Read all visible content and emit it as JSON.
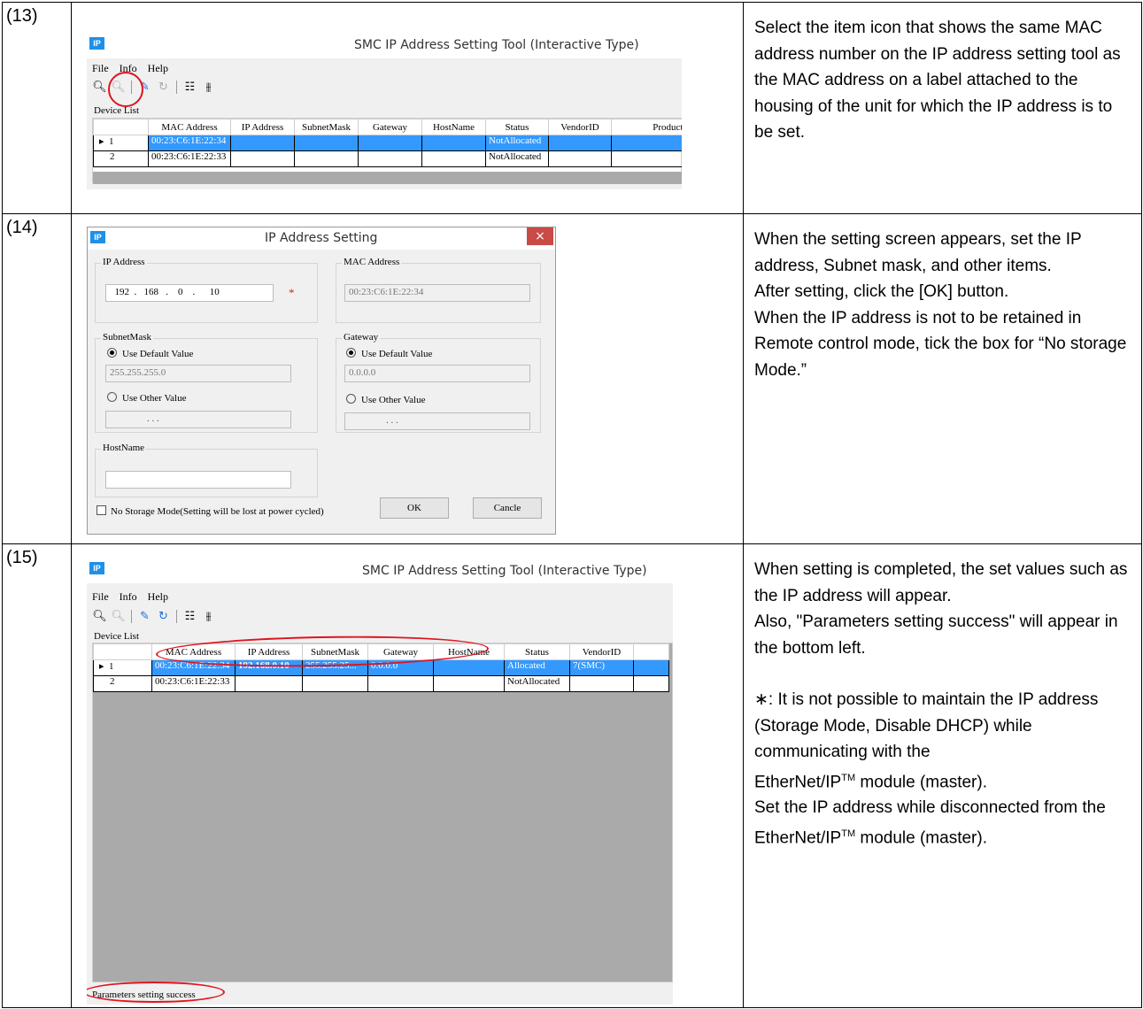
{
  "steps": [
    {
      "number": "(13)",
      "description": [
        "Select the item icon that shows the same MAC address number on the IP address setting tool as the MAC address on a label attached to the housing of the unit for which the IP address is to be set."
      ],
      "window": {
        "title": "SMC IP Address Setting Tool (Interactive Type)",
        "icon": "IP",
        "menu": [
          "File",
          "Info",
          "Help"
        ],
        "device_list_label": "Device List",
        "columns": [
          "MAC Address",
          "IP Address",
          "SubnetMask",
          "Gateway",
          "HostName",
          "Status",
          "VendorID",
          "ProductC"
        ],
        "rows": [
          {
            "index": "1",
            "mac": "00:23:C6:1E:22:34",
            "ip": "",
            "subnet": "",
            "gateway": "",
            "host": "",
            "status": "NotAllocated",
            "vendor": "",
            "product": ""
          },
          {
            "index": "2",
            "mac": "00:23:C6:1E:22:33",
            "ip": "",
            "subnet": "",
            "gateway": "",
            "host": "",
            "status": "NotAllocated",
            "vendor": "",
            "product": ""
          }
        ]
      }
    },
    {
      "number": "(14)",
      "description": [
        "When the setting screen appears, set the IP address, Subnet mask, and other items.",
        "After setting, click the [OK] button.",
        "When the IP address is not to be retained in Remote control mode, tick the box for “No storage Mode.”"
      ],
      "dialog": {
        "title": "IP Address Setting",
        "icon": "IP",
        "close": "×",
        "ip_label": "IP Address",
        "ip_parts": [
          "192",
          "168",
          "0",
          "10"
        ],
        "ip_dots": [
          ".",
          ".",
          "."
        ],
        "required_mark": "*",
        "mac_label": "MAC Address",
        "mac_value": "00:23:C6:1E:22:34",
        "subnet_label": "SubnetMask",
        "subnet_default": "Use Default Value",
        "subnet_default_value": "255.255.255.0",
        "subnet_other": "Use Other Value",
        "subnet_other_value": ".            .            .",
        "gateway_label": "Gateway",
        "gateway_default": "Use Default Value",
        "gateway_default_value": "0.0.0.0",
        "gateway_other": "Use Other Value",
        "gateway_other_value": ".            .            .",
        "hostname_label": "HostName",
        "hostname_value": "",
        "nostorage_label": "No Storage Mode(Setting will be lost at power cycled)",
        "ok_label": "OK",
        "cancel_label": "Cancle"
      }
    },
    {
      "number": "(15)",
      "description": [
        "When setting is completed, the set values such as the IP address will appear.",
        "Also, \"Parameters setting success\" will appear in the bottom left."
      ],
      "note": {
        "lines": [
          "∗: It is not possible to maintain the IP address (Storage Mode, Disable DHCP) while communicating with the"
        ],
        "tm1_pre": "EtherNet/IP",
        "tm1_sup": "TM",
        "tm1_post": " module (master).",
        "set_line": "Set the IP address while disconnected from the ",
        "tm2_pre": "EtherNet/IP",
        "tm2_sup": "TM",
        "tm2_post": " module (master)."
      },
      "window": {
        "title": "SMC IP Address Setting Tool (Interactive Type)",
        "icon": "IP",
        "menu": [
          "File",
          "Info",
          "Help"
        ],
        "device_list_label": "Device List",
        "columns": [
          "MAC Address",
          "IP Address",
          "SubnetMask",
          "Gateway",
          "HostName",
          "Status",
          "VendorID"
        ],
        "rows": [
          {
            "index": "1",
            "mac": "00:23:C6:1E:22:34",
            "ip": "192.168.0.10",
            "subnet": "255.255.25...",
            "gateway": "0.0.0.0",
            "host": "",
            "status": "Allocated",
            "vendor": "7(SMC)"
          },
          {
            "index": "2",
            "mac": "00:23:C6:1E:22:33",
            "ip": "",
            "subnet": "",
            "gateway": "",
            "host": "",
            "status": "NotAllocated",
            "vendor": ""
          }
        ],
        "status_bar": "Parameters setting success"
      }
    }
  ]
}
